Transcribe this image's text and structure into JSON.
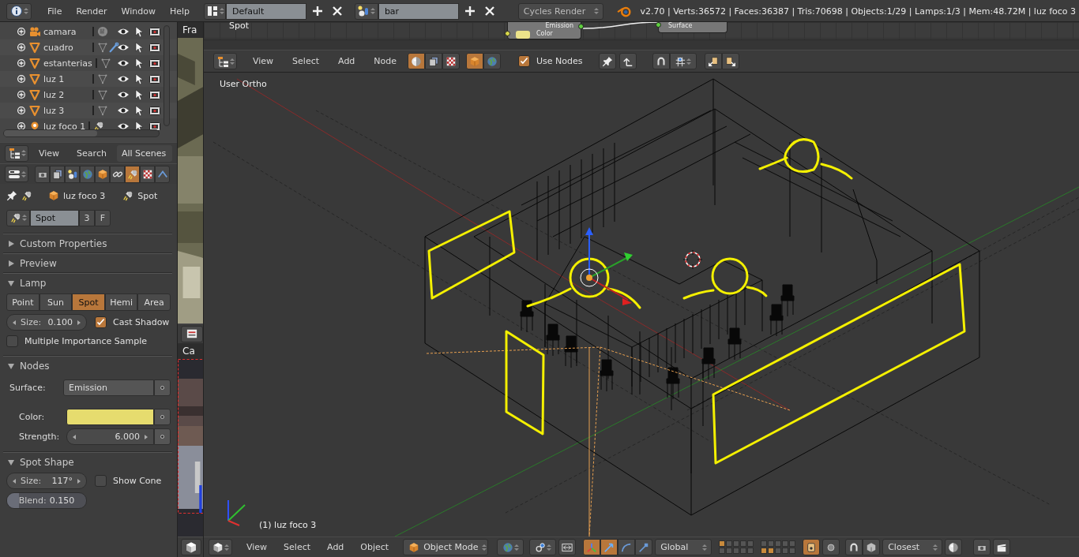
{
  "top_bar": {
    "menus": [
      "File",
      "Render",
      "Window",
      "Help"
    ],
    "screen_layout": "Default",
    "scene": "bar",
    "render_engine": "Cycles Render",
    "stats": "v2.70 | Verts:36572 | Faces:36387 | Tris:70698 | Objects:1/29 | Lamps:1/3 | Mem:48.72M | luz foco 3"
  },
  "outliner": {
    "items": [
      {
        "name": "camara",
        "kind": "camera",
        "modifier": false
      },
      {
        "name": "cuadro",
        "kind": "mesh",
        "modifier": true
      },
      {
        "name": "estanterias",
        "kind": "mesh",
        "modifier": false
      },
      {
        "name": "luz 1",
        "kind": "mesh",
        "modifier": false
      },
      {
        "name": "luz 2",
        "kind": "mesh",
        "modifier": false
      },
      {
        "name": "luz 3",
        "kind": "mesh",
        "modifier": false
      },
      {
        "name": "luz foco 1",
        "kind": "lamp",
        "modifier": false
      }
    ],
    "menus": [
      "View",
      "Search"
    ],
    "filter": "All Scenes"
  },
  "properties": {
    "context_tabs": [
      {
        "kind": "render",
        "selected": false
      },
      {
        "kind": "layers",
        "selected": false
      },
      {
        "kind": "scene",
        "selected": false
      },
      {
        "kind": "world",
        "selected": false
      },
      {
        "kind": "object",
        "selected": false
      },
      {
        "kind": "constraints",
        "selected": false
      },
      {
        "kind": "data",
        "selected": true
      },
      {
        "kind": "texture",
        "selected": false
      },
      {
        "kind": "physics",
        "selected": false
      }
    ],
    "breadcrumb": [
      "luz foco 3",
      "Spot"
    ],
    "datablock": {
      "name": "Spot",
      "users": "3",
      "fake_user": "F"
    },
    "panels": [
      {
        "title": "Custom Properties",
        "expanded": false
      },
      {
        "title": "Preview",
        "expanded": false
      },
      {
        "title": "Lamp",
        "expanded": true,
        "rows": [
          {
            "kind": "choice",
            "options": [
              {
                "label": "Point",
                "selected": false
              },
              {
                "label": "Sun",
                "selected": false
              },
              {
                "label": "Spot",
                "selected": true
              },
              {
                "label": "Hemi",
                "selected": false
              },
              {
                "label": "Area",
                "selected": false
              }
            ]
          },
          {
            "kind": "pair",
            "items": [
              {
                "kind": "number",
                "label": "Size:",
                "value": "0.100"
              },
              {
                "kind": "checkbox",
                "label": "Cast Shadow",
                "checked": true
              }
            ]
          },
          {
            "kind": "checkbox",
            "label": "Multiple Importance Sample",
            "checked": false
          }
        ]
      },
      {
        "title": "Nodes",
        "expanded": true,
        "rows": [
          {
            "kind": "socket_menu",
            "label": "Surface:",
            "value": "Emission"
          },
          {
            "kind": "socket_color",
            "label": "Color:",
            "color": "#e6dc6e"
          },
          {
            "kind": "socket_number",
            "label": "Strength:",
            "value": "6.000"
          }
        ]
      },
      {
        "title": "Spot Shape",
        "expanded": true,
        "rows": [
          {
            "kind": "pair",
            "items": [
              {
                "kind": "number",
                "label": "Size:",
                "value": "117°"
              },
              {
                "kind": "checkbox",
                "label": "Show Cone",
                "checked": false
              }
            ]
          },
          {
            "kind": "slider",
            "label": "Blend:",
            "value": "0.150",
            "level": 0.15
          }
        ]
      }
    ]
  },
  "strip": {
    "top_label": "Fra",
    "bottom_label": "Ca"
  },
  "node_editor": {
    "frame_label": "Spot",
    "node_output": "Emission",
    "node_input": "Color",
    "output_node_input": "Surface",
    "menus": [
      "View",
      "Select",
      "Add",
      "Node"
    ],
    "shader_types": [
      {
        "kind": "shader",
        "selected": true
      },
      {
        "kind": "texture",
        "selected": false
      },
      {
        "kind": "compositing",
        "selected": false
      }
    ],
    "shader_source": [
      {
        "kind": "object",
        "selected": true
      },
      {
        "kind": "world",
        "selected": false
      }
    ],
    "use_nodes": {
      "label": "Use Nodes",
      "checked": true
    }
  },
  "viewport": {
    "view_label": "User Ortho",
    "object_label": "(1) luz foco 3"
  },
  "view_header": {
    "menus": [
      "View",
      "Select",
      "Add",
      "Object"
    ],
    "mode": "Object Mode",
    "orientation": "Global",
    "snap_target": "Closest"
  }
}
